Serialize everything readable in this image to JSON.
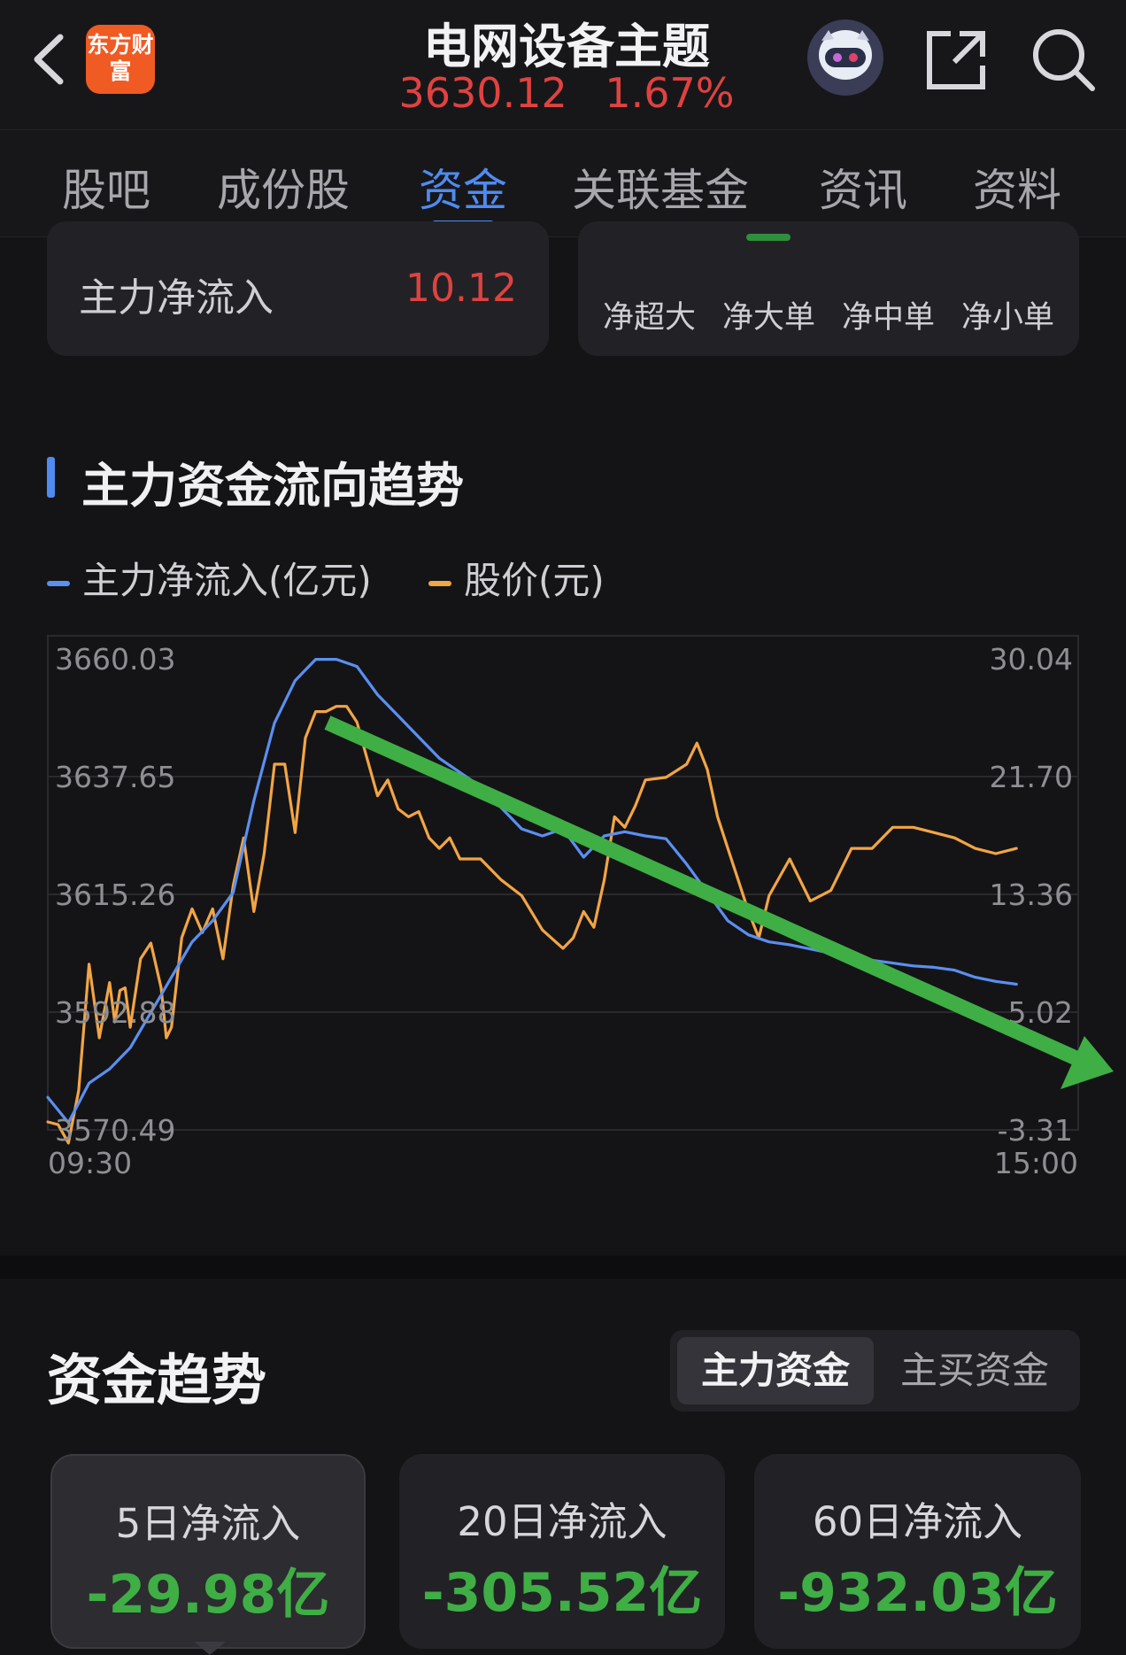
{
  "header": {
    "logo_text": "东方财富",
    "title": "电网设备主题",
    "price": "3630.12",
    "change_pct": "1.67%"
  },
  "tabs": [
    "股吧",
    "成份股",
    "资金",
    "关联基金",
    "资讯",
    "资料"
  ],
  "active_tab": "资金",
  "main_inflow": {
    "label": "主力净流入",
    "value": "10.12"
  },
  "order_legend": [
    "净超大",
    "净大单",
    "净中单",
    "净小单"
  ],
  "trend_section": {
    "title": "主力资金流向趋势",
    "legend_inflow": "主力净流入(亿元)",
    "legend_price": "股价(元)"
  },
  "chart_data": {
    "type": "line",
    "x_start": "09:30",
    "x_end": "15:00",
    "left_axis_ticks": [
      "3660.03",
      "3637.65",
      "3615.26",
      "3592.88",
      "3570.49"
    ],
    "right_axis_ticks": [
      "30.04",
      "21.70",
      "13.36",
      "5.02",
      "-3.31"
    ],
    "left_ylim": [
      3570.49,
      3660.03
    ],
    "right_ylim": [
      -3.31,
      30.04
    ],
    "series": [
      {
        "name": "股价(元)",
        "axis": "left",
        "color": "#f2a545",
        "x": [
          0,
          0.01,
          0.02,
          0.03,
          0.04,
          0.05,
          0.06,
          0.065,
          0.07,
          0.075,
          0.08,
          0.09,
          0.1,
          0.11,
          0.115,
          0.12,
          0.13,
          0.14,
          0.15,
          0.16,
          0.17,
          0.18,
          0.19,
          0.2,
          0.21,
          0.22,
          0.23,
          0.24,
          0.25,
          0.26,
          0.27,
          0.28,
          0.29,
          0.3,
          0.31,
          0.32,
          0.33,
          0.34,
          0.35,
          0.36,
          0.37,
          0.38,
          0.39,
          0.4,
          0.42,
          0.44,
          0.46,
          0.48,
          0.5,
          0.51,
          0.52,
          0.53,
          0.54,
          0.55,
          0.56,
          0.57,
          0.58,
          0.6,
          0.62,
          0.63,
          0.64,
          0.65,
          0.66,
          0.67,
          0.68,
          0.69,
          0.7,
          0.72,
          0.74,
          0.76,
          0.78,
          0.8,
          0.82,
          0.84,
          0.86,
          0.88,
          0.9,
          0.92,
          0.94
        ],
        "y": [
          3572.0,
          3571.5,
          3568.0,
          3578.0,
          3602.0,
          3588.0,
          3598.5,
          3591.0,
          3597.0,
          3597.5,
          3590.0,
          3603.0,
          3606.0,
          3597.5,
          3588.0,
          3590.0,
          3607.0,
          3612.5,
          3608.0,
          3612.5,
          3603.0,
          3617.0,
          3626.0,
          3612.0,
          3623.0,
          3640.0,
          3640.0,
          3627.0,
          3645.0,
          3650.0,
          3650.0,
          3651.0,
          3651.0,
          3648.0,
          3641.0,
          3634.0,
          3637.0,
          3631.5,
          3630.0,
          3631.0,
          3626.0,
          3624.0,
          3626.0,
          3622.0,
          3622.0,
          3618.0,
          3615.0,
          3608.5,
          3605.0,
          3607.0,
          3612.0,
          3609.0,
          3618.0,
          3630.0,
          3628.0,
          3632.0,
          3637.0,
          3637.5,
          3640.0,
          3644.0,
          3639.0,
          3630.0,
          3624.0,
          3618.0,
          3612.0,
          3607.0,
          3615.0,
          3622.0,
          3614.0,
          3616.0,
          3624.0,
          3624.0,
          3628.0,
          3628.0,
          3627.0,
          3626.0,
          3624.0,
          3623.0,
          3624.0
        ]
      },
      {
        "name": "主力净流入(亿元)",
        "axis": "right",
        "color": "#5b8ff0",
        "x": [
          0,
          0.02,
          0.04,
          0.06,
          0.08,
          0.1,
          0.12,
          0.14,
          0.16,
          0.18,
          0.2,
          0.22,
          0.24,
          0.26,
          0.28,
          0.3,
          0.32,
          0.34,
          0.36,
          0.38,
          0.4,
          0.42,
          0.44,
          0.46,
          0.48,
          0.5,
          0.52,
          0.54,
          0.56,
          0.58,
          0.6,
          0.62,
          0.64,
          0.66,
          0.68,
          0.7,
          0.72,
          0.74,
          0.76,
          0.78,
          0.8,
          0.82,
          0.84,
          0.86,
          0.88,
          0.9,
          0.92,
          0.94
        ],
        "y": [
          -1.0,
          -2.8,
          0.0,
          1.0,
          2.5,
          5.0,
          7.5,
          10.0,
          11.5,
          13.5,
          20.0,
          25.5,
          28.5,
          30.0,
          30.0,
          29.5,
          27.5,
          26.0,
          24.5,
          23.0,
          22.0,
          21.0,
          19.5,
          18.0,
          17.5,
          18.0,
          16.0,
          17.5,
          17.8,
          17.5,
          17.3,
          15.5,
          13.5,
          11.5,
          10.5,
          10.0,
          9.8,
          9.5,
          9.2,
          9.0,
          8.7,
          8.5,
          8.3,
          8.2,
          8.0,
          7.5,
          7.2,
          7.0
        ]
      }
    ]
  },
  "trend2_section": {
    "title": "资金趋势",
    "toggle_options": [
      "主力资金",
      "主买资金"
    ],
    "toggle_selected": "主力资金"
  },
  "stats": [
    {
      "label": "5日净流入",
      "value": "-29.98亿"
    },
    {
      "label": "20日净流入",
      "value": "-305.52亿"
    },
    {
      "label": "60日净流入",
      "value": "-932.03亿"
    }
  ],
  "colors": {
    "up_red": "#e0423f",
    "down_green": "#3fae45",
    "accent_blue": "#4f8bf0",
    "annotation_green": "#3fae45"
  }
}
